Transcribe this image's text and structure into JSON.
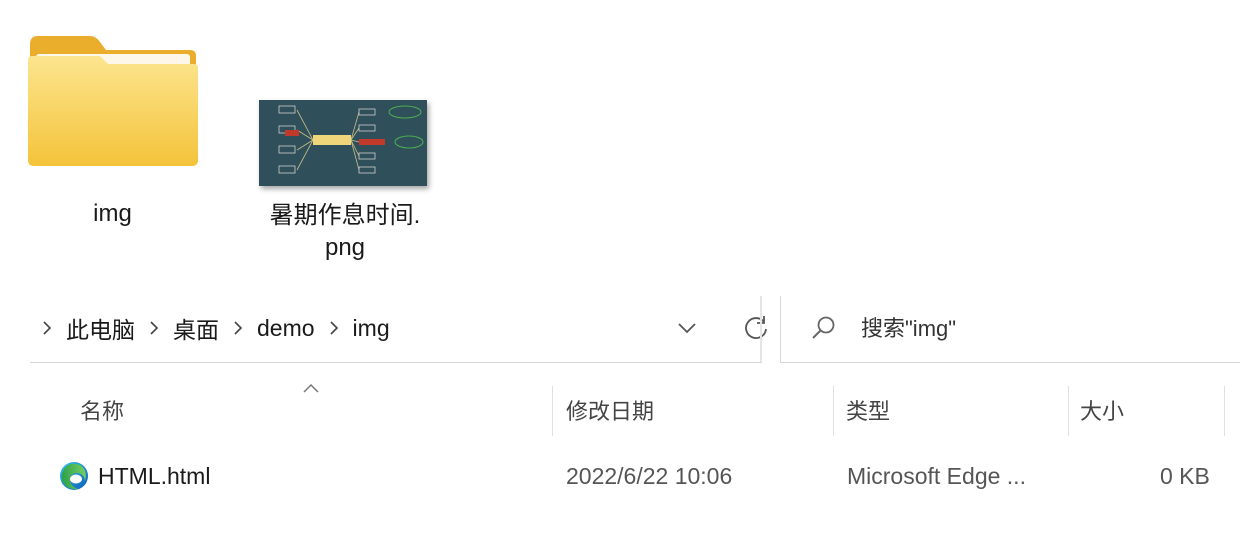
{
  "desktop_items": [
    {
      "label": "img",
      "icon": "folder-icon"
    },
    {
      "label": "暑期作息时间.\npng",
      "icon": "image-thumbnail"
    }
  ],
  "address_bar": {
    "crumbs": [
      "此电脑",
      "桌面",
      "demo",
      "img"
    ],
    "dropdown_icon": "chevron-down-icon",
    "refresh_icon": "refresh-icon"
  },
  "search": {
    "placeholder": "搜索\"img\"",
    "icon": "search-icon"
  },
  "columns": {
    "name": "名称",
    "modified": "修改日期",
    "type": "类型",
    "size": "大小"
  },
  "files": [
    {
      "name": "HTML.html",
      "modified": "2022/6/22 10:06",
      "type": "Microsoft Edge ...",
      "size": "0 KB",
      "icon": "edge-icon"
    }
  ],
  "colors": {
    "folder": "#F5C542",
    "folder_back": "#E8A825",
    "thumb_bg": "#2f4f5a"
  }
}
